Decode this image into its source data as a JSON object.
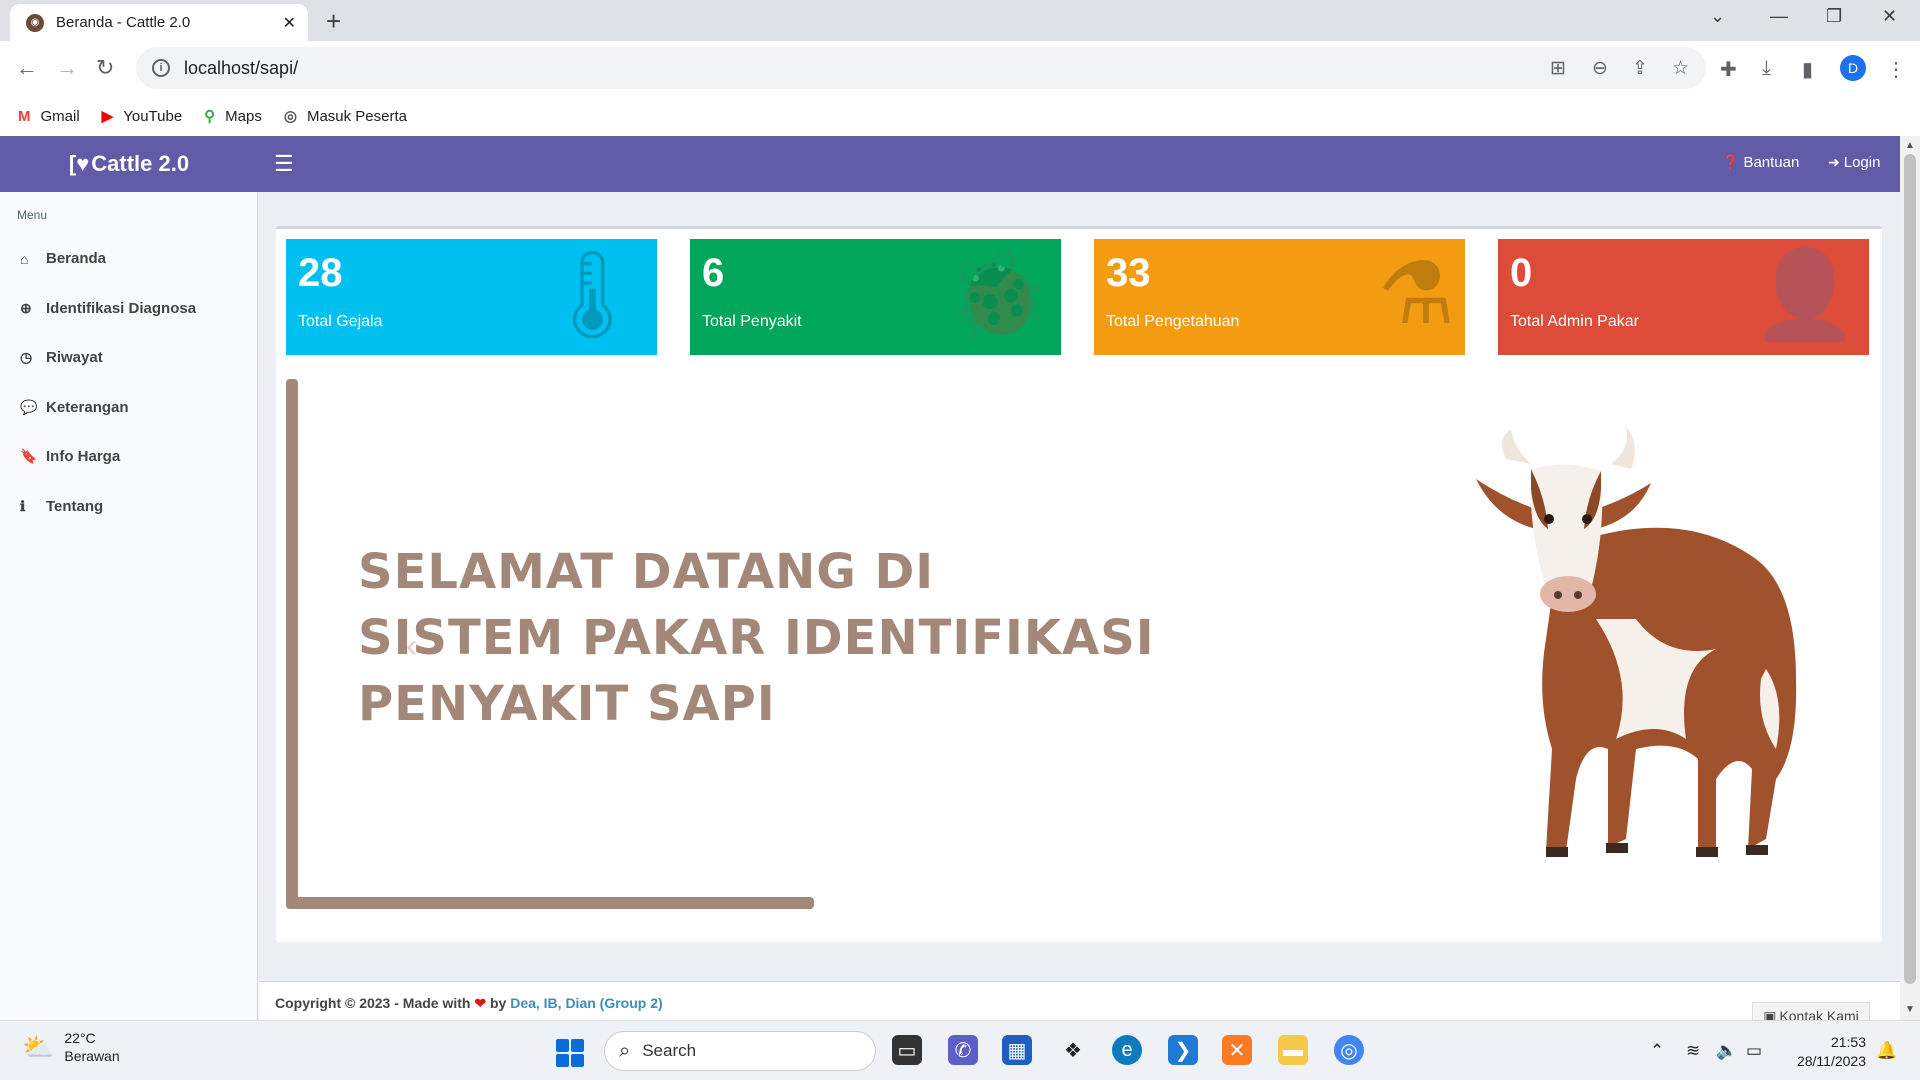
{
  "browser": {
    "tab_title": "Beranda - Cattle 2.0",
    "url": "localhost/sapi/",
    "profile_initial": "D",
    "bookmarks": [
      {
        "label": "Gmail",
        "icon": "gmail-icon"
      },
      {
        "label": "YouTube",
        "icon": "youtube-icon"
      },
      {
        "label": "Maps",
        "icon": "maps-icon"
      },
      {
        "label": "Masuk Peserta",
        "icon": "globe-icon"
      }
    ]
  },
  "app": {
    "logo_text": "Cattle 2.0",
    "nav": {
      "help_label": "Bantuan",
      "login_label": "Login"
    },
    "sidebar": {
      "header": "Menu",
      "items": [
        {
          "label": "Beranda",
          "icon": "home-icon"
        },
        {
          "label": "Identifikasi Diagnosa",
          "icon": "search-plus-icon"
        },
        {
          "label": "Riwayat",
          "icon": "clock-icon"
        },
        {
          "label": "Keterangan",
          "icon": "comment-icon"
        },
        {
          "label": "Info Harga",
          "icon": "bookmark-icon"
        },
        {
          "label": "Tentang",
          "icon": "info-icon"
        }
      ]
    },
    "stats": [
      {
        "value": "28",
        "label": "Total Gejala",
        "color": "#00c0ef",
        "icon": "thermometer-icon"
      },
      {
        "value": "6",
        "label": "Total Penyakit",
        "color": "#00a65a",
        "icon": "bug-icon"
      },
      {
        "value": "33",
        "label": "Total Pengetahuan",
        "color": "#f39c12",
        "icon": "flask-icon"
      },
      {
        "value": "0",
        "label": "Total Admin Pakar",
        "color": "#dd4b39",
        "icon": "user-plus-icon"
      }
    ],
    "banner": {
      "line1": "SELAMAT DATANG DI",
      "line2": "SISTEM PAKAR IDENTIFIKASI",
      "line3": "PENYAKIT SAPI"
    },
    "footer": {
      "copyright": "Copyright © 2023 - Made with",
      "by": "by",
      "team": "Dea, IB, Dian (Group 2)",
      "contact": "Kontak Kami"
    }
  },
  "taskbar": {
    "temp": "22°C",
    "condition": "Berawan",
    "search_placeholder": "Search",
    "time": "21:53",
    "date": "28/11/2023"
  },
  "colors": {
    "navbar": "#605ca8",
    "banner_text": "#a3887a"
  }
}
